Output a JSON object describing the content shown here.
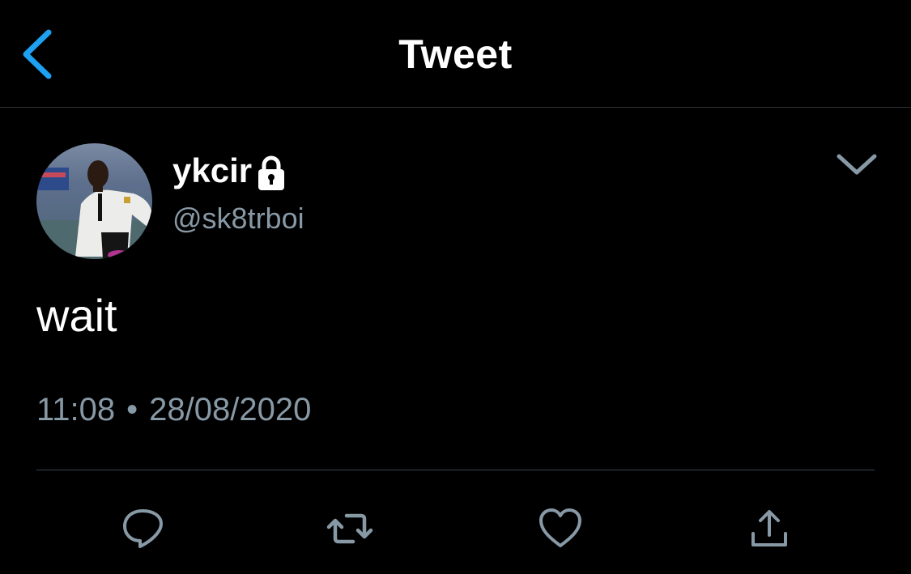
{
  "header": {
    "title": "Tweet",
    "back_icon": "chevron-left-icon",
    "accent": "#1da1f2"
  },
  "tweet": {
    "author": {
      "display_name": "ykcir",
      "handle": "@sk8trboi",
      "protected_icon": "lock-icon"
    },
    "text": "wait",
    "time": "11:08",
    "separator": "•",
    "date": "28/08/2020",
    "menu_icon": "chevron-down-icon"
  },
  "actions": [
    {
      "name": "reply",
      "icon": "reply-icon"
    },
    {
      "name": "retweet",
      "icon": "retweet-icon"
    },
    {
      "name": "like",
      "icon": "heart-icon"
    },
    {
      "name": "share",
      "icon": "share-icon"
    }
  ],
  "colors": {
    "background": "#000000",
    "text_primary": "#ffffff",
    "text_secondary": "#8899a6",
    "divider": "#38444d",
    "icon": "#8899a6"
  }
}
